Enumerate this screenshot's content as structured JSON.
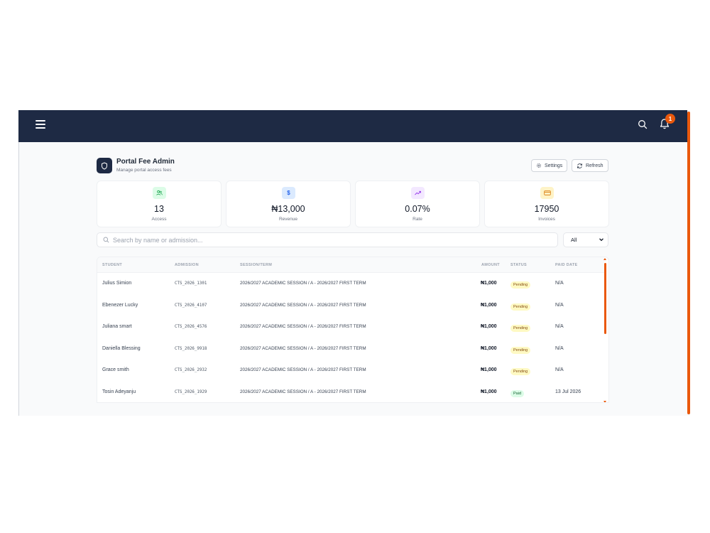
{
  "header": {
    "notification_count": "1"
  },
  "page": {
    "title": "Portal Fee Admin",
    "subtitle": "Manage portal access fees",
    "settings_label": "Settings",
    "refresh_label": "Refresh"
  },
  "stats": [
    {
      "value": "13",
      "label": "Access",
      "icon": "users-icon",
      "bg": "#dcfce7",
      "color": "#16a34a"
    },
    {
      "value": "₦13,000",
      "label": "Revenue",
      "icon": "dollar-icon",
      "bg": "#dbeafe",
      "color": "#2563eb"
    },
    {
      "value": "0.07%",
      "label": "Rate",
      "icon": "trending-up-icon",
      "bg": "#f3e8ff",
      "color": "#9333ea"
    },
    {
      "value": "17950",
      "label": "Invoices",
      "icon": "credit-card-icon",
      "bg": "#fef3c7",
      "color": "#d97706"
    }
  ],
  "search": {
    "placeholder": "Search by name or admission..."
  },
  "filter": {
    "selected": "All"
  },
  "table": {
    "columns": [
      "STUDENT",
      "ADMISSION",
      "SESSION/TERM",
      "AMOUNT",
      "STATUS",
      "PAID DATE"
    ],
    "rows": [
      {
        "student": "Julius Simion",
        "admission": "CTS_2026_1301",
        "session": "2026/2027 ACADEMIC SESSION / A - 2026/2027 FIRST TERM",
        "amount": "₦1,000",
        "status": "Pending",
        "paid_date": "N/A"
      },
      {
        "student": "Ebenezer Lucky",
        "admission": "CTS_2026_4107",
        "session": "2026/2027 ACADEMIC SESSION / A - 2026/2027 FIRST TERM",
        "amount": "₦1,000",
        "status": "Pending",
        "paid_date": "N/A"
      },
      {
        "student": "Juliana smart",
        "admission": "CTS_2026_4576",
        "session": "2026/2027 ACADEMIC SESSION / A - 2026/2027 FIRST TERM",
        "amount": "₦1,000",
        "status": "Pending",
        "paid_date": "N/A"
      },
      {
        "student": "Daniella Blessing",
        "admission": "CTS_2026_9918",
        "session": "2026/2027 ACADEMIC SESSION / A - 2026/2027 FIRST TERM",
        "amount": "₦1,000",
        "status": "Pending",
        "paid_date": "N/A"
      },
      {
        "student": "Grace smith",
        "admission": "CTS_2026_2932",
        "session": "2026/2027 ACADEMIC SESSION / A - 2026/2027 FIRST TERM",
        "amount": "₦1,000",
        "status": "Pending",
        "paid_date": "N/A"
      },
      {
        "student": "Tosin Adeyanju",
        "admission": "CTS_2026_1929",
        "session": "2026/2027 ACADEMIC SESSION / A - 2026/2027 FIRST TERM",
        "amount": "₦1,000",
        "status": "Paid",
        "paid_date": "13 Jul 2026"
      }
    ]
  },
  "colors": {
    "topbar": "#1e2a44",
    "accent": "#ea580c"
  }
}
